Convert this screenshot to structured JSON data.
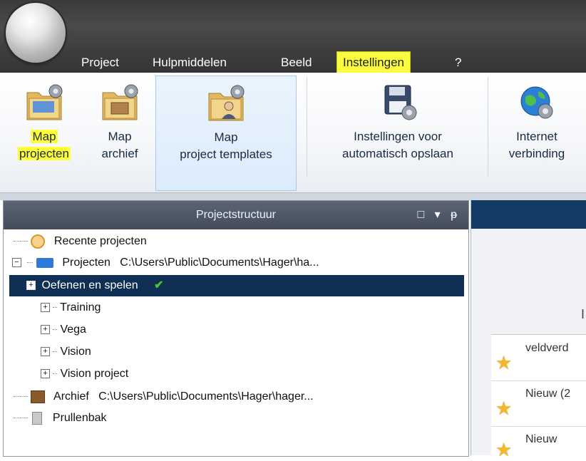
{
  "menu": {
    "items": [
      "Project",
      "Hulpmiddelen",
      "Beeld",
      "Instellingen",
      "?"
    ],
    "active": "Instellingen"
  },
  "ribbon": {
    "map_projecten": [
      "Map",
      "projecten"
    ],
    "map_archief": [
      "Map",
      "archief"
    ],
    "map_templates": [
      "Map",
      "project templates"
    ],
    "autosave": [
      "Instellingen voor",
      "automatisch opslaan"
    ],
    "internet": [
      "Internet",
      "verbinding"
    ]
  },
  "panel": {
    "title": "Projectstructuur",
    "tools": [
      "□",
      "▾",
      "ᵽ"
    ]
  },
  "tree": {
    "recent": "Recente projecten",
    "projecten_label": "Projecten",
    "projecten_path": "C:\\Users\\Public\\Documents\\Hager\\ha...",
    "oefenen": "Oefenen en spelen",
    "training": "Training",
    "vega": "Vega",
    "vision": "Vision",
    "vision_project": "Vision project",
    "archief_label": "Archief",
    "archief_path": "C:\\Users\\Public\\Documents\\Hager\\hager...",
    "prullenbak": "Prullenbak"
  },
  "right": {
    "edge_letter": "I",
    "items": [
      "veldverd",
      "Nieuw (2",
      "Nieuw"
    ]
  },
  "colors": {
    "highlight": "#ffff3a",
    "selected_row": "#0f2f55",
    "star": "#f5b82a"
  }
}
